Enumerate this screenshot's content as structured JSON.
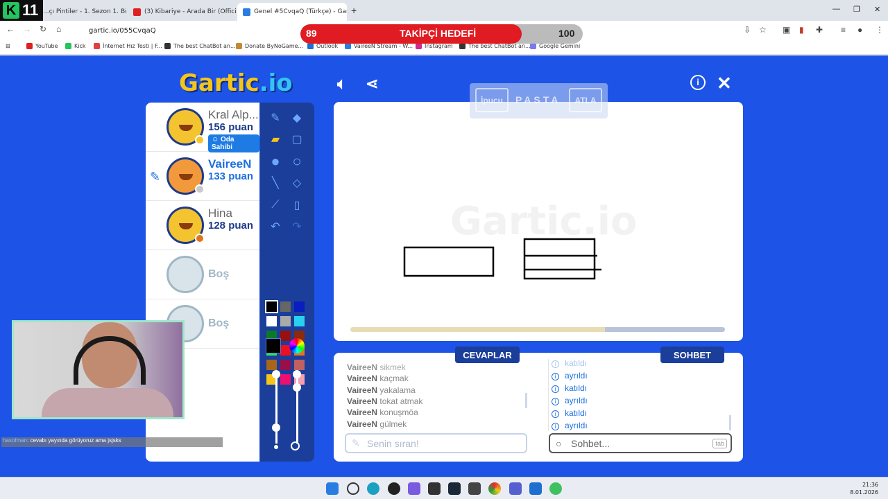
{
  "browser": {
    "tabs": [
      {
        "title": "...çı Pintiler - 1. Sezon 1. Bö",
        "active": false
      },
      {
        "title": "(3) Kibariye - Arada Bir (Official",
        "active": false
      },
      {
        "title": "Genel #5CvqaQ (Türkçe) - Gart",
        "active": true
      }
    ],
    "url": "gartic.io/055CvqaQ",
    "bookmarks": [
      "YouTube",
      "Kick",
      "İnternet Hız Testi | F...",
      "The best ChatBot an...",
      "Donate ByNoGame...",
      "Outlook",
      "VaireeN Stream - W...",
      "Instagram",
      "The best ChatBot an...",
      "Google Gemini"
    ]
  },
  "overlay": {
    "badge": "11",
    "follow_goal": {
      "label": "TAKİPÇİ HEDEFİ",
      "current": "89",
      "target": "100",
      "fraction": 0.89
    },
    "chat_user": "hasofman",
    "chat_message": ": cevabı yayında görüyoruz ama jsjsks"
  },
  "game": {
    "logo_main": "Gartic",
    "logo_sub": ".io",
    "hint_button": "İpucu",
    "word": "PASTA",
    "skip_button": "ATLA",
    "watermark": "Gartic.io",
    "players": [
      {
        "name": "Kral Alp...",
        "score": "156 puan",
        "badge": "Oda Sahibi",
        "dot": "#f4c430"
      },
      {
        "name": "VaireeN",
        "score": "133 puan",
        "drawing": true,
        "dot": "#c9c9c9"
      },
      {
        "name": "Hina",
        "score": "128 puan",
        "dot": "#e0741c"
      },
      {
        "name": "Boş"
      },
      {
        "name": "Boş"
      }
    ],
    "round_progress": 0.68,
    "answers_title": "CEVAPLAR",
    "chat_title": "SOHBET",
    "answers": [
      {
        "user": "VaireeN",
        "text": "sikmek"
      },
      {
        "user": "VaireeN",
        "text": "kaçmak"
      },
      {
        "user": "VaireeN",
        "text": "yakalama"
      },
      {
        "user": "VaireeN",
        "text": "tokat atmak"
      },
      {
        "user": "VaireeN",
        "text": "konuşmöa"
      },
      {
        "user": "VaireeN",
        "text": "gülmek"
      }
    ],
    "chat_events": [
      "katıldı",
      "ayrıldı",
      "katıldı",
      "ayrıldı",
      "katıldı",
      "ayrıldı"
    ],
    "answer_placeholder": "Senin sıran!",
    "chat_placeholder": "Sohbet...",
    "tab_hint": "tab",
    "palette": [
      "#000000",
      "#666666",
      "#0a1dbf",
      "#ffffff",
      "#aaaaaa",
      "#2ad0f0",
      "#0a7a2a",
      "#99100f",
      "#8a2a10",
      "#2ee06a",
      "#ee1020",
      "#f07020",
      "#a8661a",
      "#9a0f4a",
      "#c06060",
      "#f5c518",
      "#ee1070",
      "#f4a0b0"
    ]
  },
  "taskbar": {
    "time": "21:36",
    "date": "8.01.2026"
  }
}
